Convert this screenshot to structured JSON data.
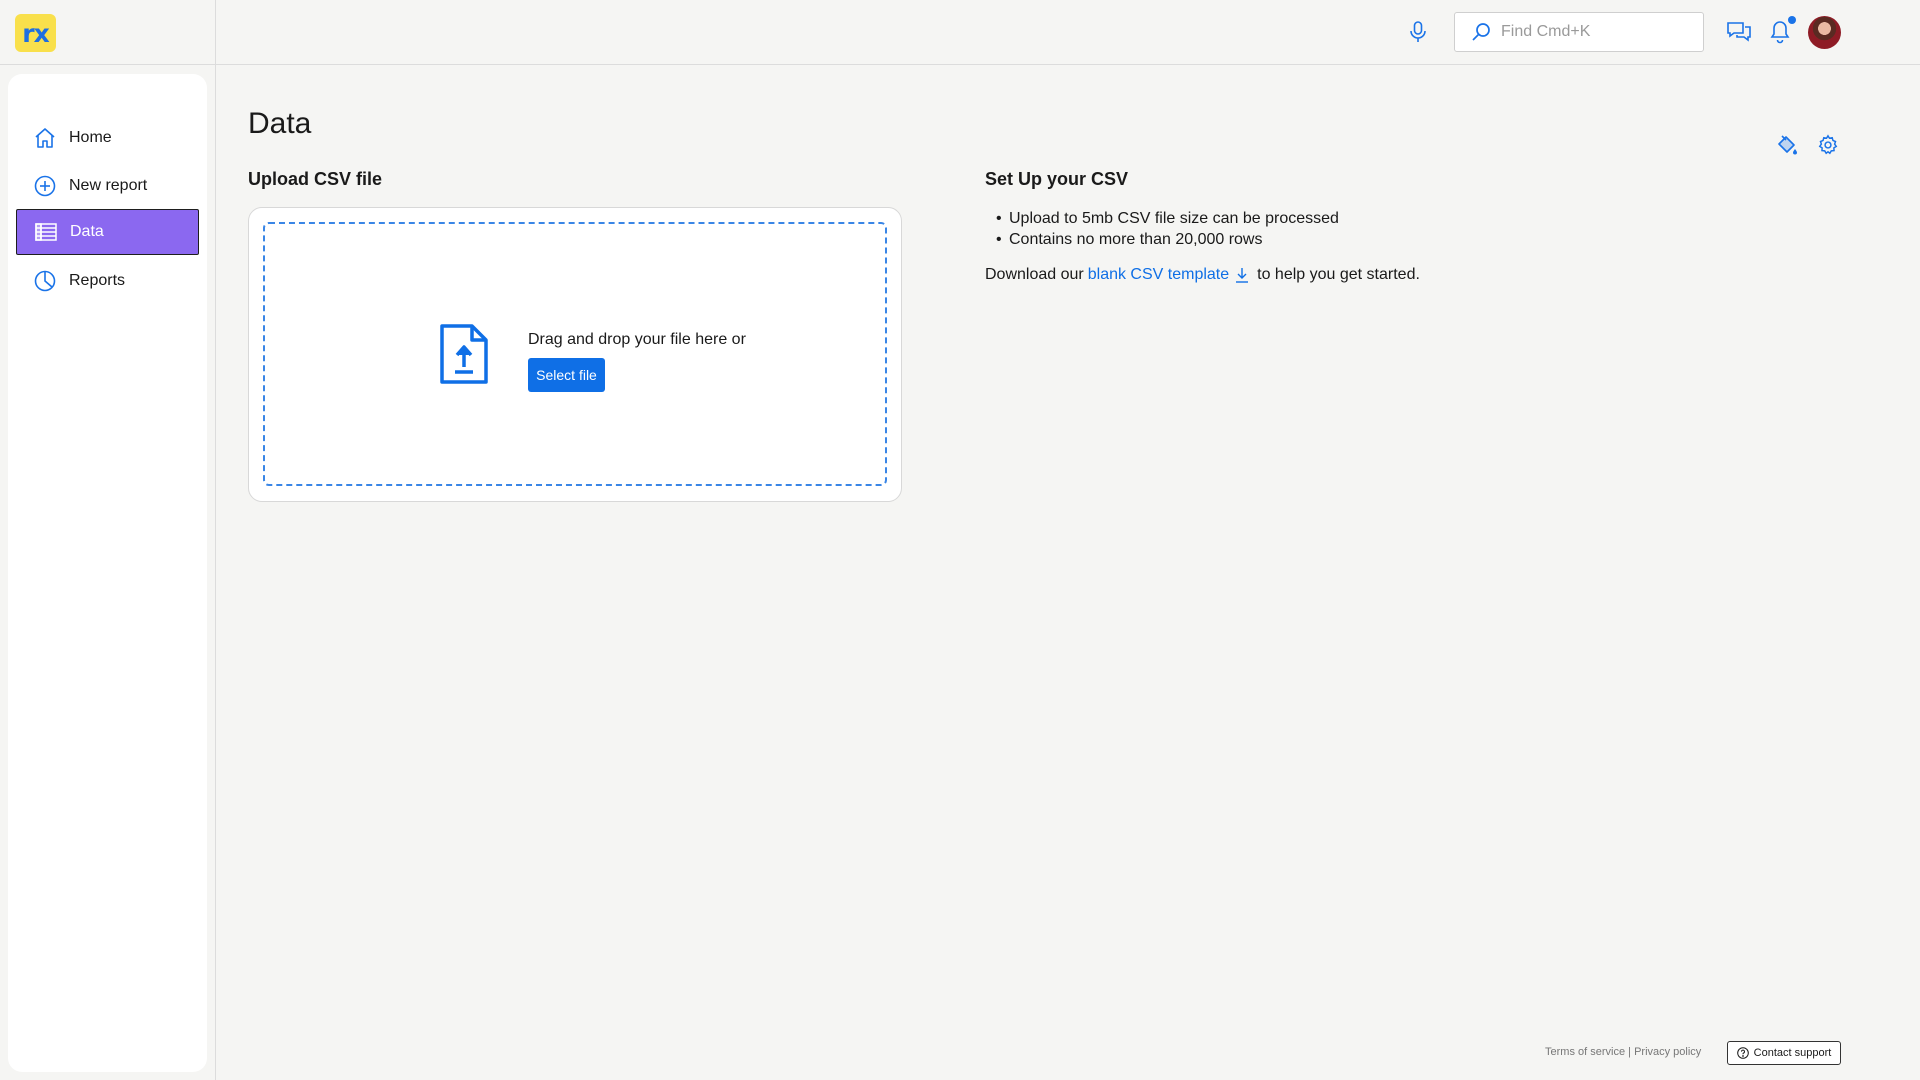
{
  "app": {
    "logo_text": "rx",
    "accent_color": "#8b68f0",
    "link_color": "#0f6fe6"
  },
  "header": {
    "search_placeholder": "Find Cmd+K",
    "icons": [
      "microphone-icon",
      "search-icon",
      "chat-icon",
      "bell-icon",
      "avatar"
    ],
    "notification_unread": true
  },
  "sidebar": {
    "items": [
      {
        "label": "Home",
        "icon": "home-icon",
        "active": false
      },
      {
        "label": "New report",
        "icon": "plus-circle-icon",
        "active": false
      },
      {
        "label": "Data",
        "icon": "table-icon",
        "active": true
      },
      {
        "label": "Reports",
        "icon": "pie-chart-icon",
        "active": false
      }
    ]
  },
  "main": {
    "title": "Data",
    "toolbar_icons": [
      "paint-bucket-icon",
      "gear-icon"
    ],
    "upload": {
      "heading": "Upload CSV file",
      "drop_text": "Drag and drop your file here or",
      "select_label": "Select file"
    },
    "setup": {
      "heading": "Set Up your CSV",
      "requirements": [
        "Upload to 5mb CSV file size can be processed",
        "Contains no more than 20,000 rows"
      ],
      "download_prefix": "Download our",
      "download_link": "blank CSV template",
      "download_suffix": "to help you get started."
    }
  },
  "footer": {
    "terms": "Terms of service",
    "separator": " | ",
    "privacy": "Privacy policy",
    "contact": "Contact support"
  }
}
